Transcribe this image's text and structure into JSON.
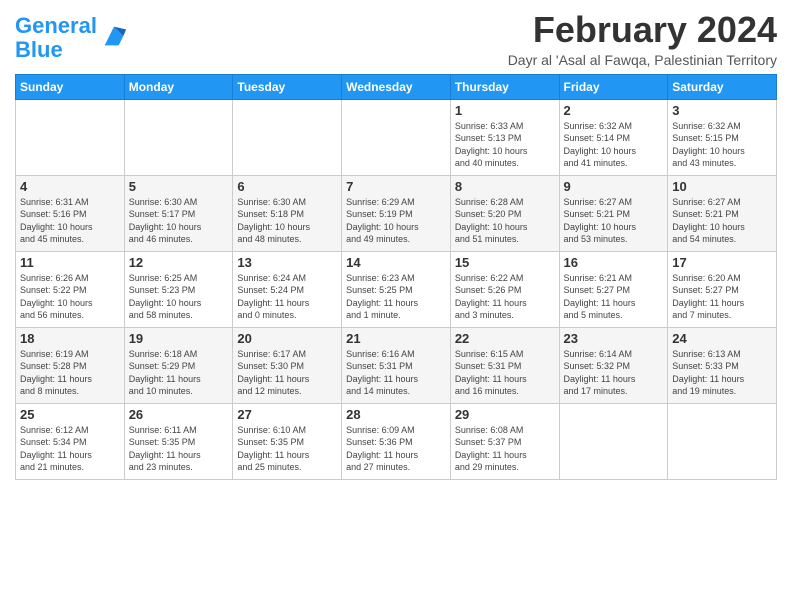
{
  "logo": {
    "text_general": "General",
    "text_blue": "Blue"
  },
  "title": "February 2024",
  "subtitle": "Dayr al 'Asal al Fawqa, Palestinian Territory",
  "days_of_week": [
    "Sunday",
    "Monday",
    "Tuesday",
    "Wednesday",
    "Thursday",
    "Friday",
    "Saturday"
  ],
  "weeks": [
    [
      {
        "day": "",
        "info": ""
      },
      {
        "day": "",
        "info": ""
      },
      {
        "day": "",
        "info": ""
      },
      {
        "day": "",
        "info": ""
      },
      {
        "day": "1",
        "info": "Sunrise: 6:33 AM\nSunset: 5:13 PM\nDaylight: 10 hours\nand 40 minutes."
      },
      {
        "day": "2",
        "info": "Sunrise: 6:32 AM\nSunset: 5:14 PM\nDaylight: 10 hours\nand 41 minutes."
      },
      {
        "day": "3",
        "info": "Sunrise: 6:32 AM\nSunset: 5:15 PM\nDaylight: 10 hours\nand 43 minutes."
      }
    ],
    [
      {
        "day": "4",
        "info": "Sunrise: 6:31 AM\nSunset: 5:16 PM\nDaylight: 10 hours\nand 45 minutes."
      },
      {
        "day": "5",
        "info": "Sunrise: 6:30 AM\nSunset: 5:17 PM\nDaylight: 10 hours\nand 46 minutes."
      },
      {
        "day": "6",
        "info": "Sunrise: 6:30 AM\nSunset: 5:18 PM\nDaylight: 10 hours\nand 48 minutes."
      },
      {
        "day": "7",
        "info": "Sunrise: 6:29 AM\nSunset: 5:19 PM\nDaylight: 10 hours\nand 49 minutes."
      },
      {
        "day": "8",
        "info": "Sunrise: 6:28 AM\nSunset: 5:20 PM\nDaylight: 10 hours\nand 51 minutes."
      },
      {
        "day": "9",
        "info": "Sunrise: 6:27 AM\nSunset: 5:21 PM\nDaylight: 10 hours\nand 53 minutes."
      },
      {
        "day": "10",
        "info": "Sunrise: 6:27 AM\nSunset: 5:21 PM\nDaylight: 10 hours\nand 54 minutes."
      }
    ],
    [
      {
        "day": "11",
        "info": "Sunrise: 6:26 AM\nSunset: 5:22 PM\nDaylight: 10 hours\nand 56 minutes."
      },
      {
        "day": "12",
        "info": "Sunrise: 6:25 AM\nSunset: 5:23 PM\nDaylight: 10 hours\nand 58 minutes."
      },
      {
        "day": "13",
        "info": "Sunrise: 6:24 AM\nSunset: 5:24 PM\nDaylight: 11 hours\nand 0 minutes."
      },
      {
        "day": "14",
        "info": "Sunrise: 6:23 AM\nSunset: 5:25 PM\nDaylight: 11 hours\nand 1 minute."
      },
      {
        "day": "15",
        "info": "Sunrise: 6:22 AM\nSunset: 5:26 PM\nDaylight: 11 hours\nand 3 minutes."
      },
      {
        "day": "16",
        "info": "Sunrise: 6:21 AM\nSunset: 5:27 PM\nDaylight: 11 hours\nand 5 minutes."
      },
      {
        "day": "17",
        "info": "Sunrise: 6:20 AM\nSunset: 5:27 PM\nDaylight: 11 hours\nand 7 minutes."
      }
    ],
    [
      {
        "day": "18",
        "info": "Sunrise: 6:19 AM\nSunset: 5:28 PM\nDaylight: 11 hours\nand 8 minutes."
      },
      {
        "day": "19",
        "info": "Sunrise: 6:18 AM\nSunset: 5:29 PM\nDaylight: 11 hours\nand 10 minutes."
      },
      {
        "day": "20",
        "info": "Sunrise: 6:17 AM\nSunset: 5:30 PM\nDaylight: 11 hours\nand 12 minutes."
      },
      {
        "day": "21",
        "info": "Sunrise: 6:16 AM\nSunset: 5:31 PM\nDaylight: 11 hours\nand 14 minutes."
      },
      {
        "day": "22",
        "info": "Sunrise: 6:15 AM\nSunset: 5:31 PM\nDaylight: 11 hours\nand 16 minutes."
      },
      {
        "day": "23",
        "info": "Sunrise: 6:14 AM\nSunset: 5:32 PM\nDaylight: 11 hours\nand 17 minutes."
      },
      {
        "day": "24",
        "info": "Sunrise: 6:13 AM\nSunset: 5:33 PM\nDaylight: 11 hours\nand 19 minutes."
      }
    ],
    [
      {
        "day": "25",
        "info": "Sunrise: 6:12 AM\nSunset: 5:34 PM\nDaylight: 11 hours\nand 21 minutes."
      },
      {
        "day": "26",
        "info": "Sunrise: 6:11 AM\nSunset: 5:35 PM\nDaylight: 11 hours\nand 23 minutes."
      },
      {
        "day": "27",
        "info": "Sunrise: 6:10 AM\nSunset: 5:35 PM\nDaylight: 11 hours\nand 25 minutes."
      },
      {
        "day": "28",
        "info": "Sunrise: 6:09 AM\nSunset: 5:36 PM\nDaylight: 11 hours\nand 27 minutes."
      },
      {
        "day": "29",
        "info": "Sunrise: 6:08 AM\nSunset: 5:37 PM\nDaylight: 11 hours\nand 29 minutes."
      },
      {
        "day": "",
        "info": ""
      },
      {
        "day": "",
        "info": ""
      }
    ]
  ]
}
